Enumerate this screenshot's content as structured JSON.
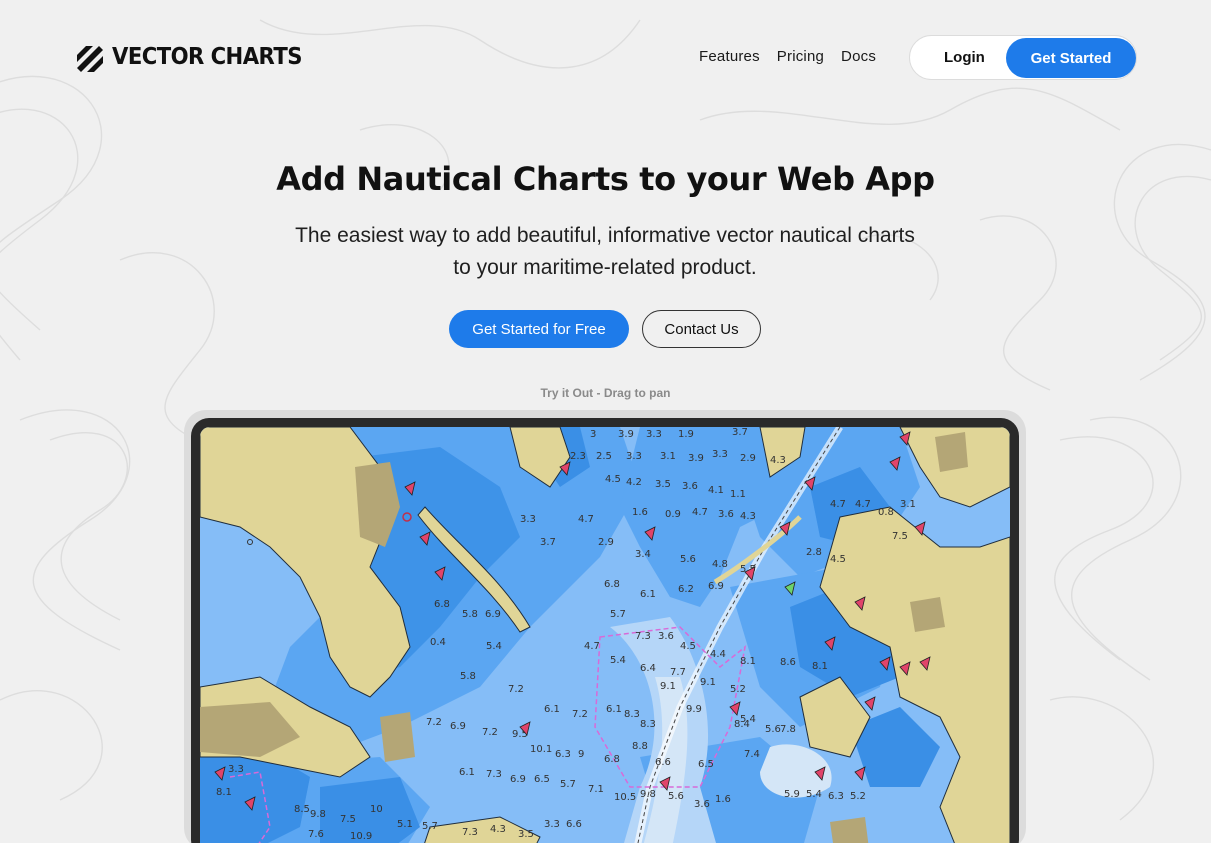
{
  "brand": {
    "name": "VECTOR CHARTS",
    "logo_icon": "diagonal-stripes-logo"
  },
  "nav": {
    "items": [
      {
        "label": "Features"
      },
      {
        "label": "Pricing"
      },
      {
        "label": "Docs"
      }
    ],
    "login_label": "Login",
    "get_started_label": "Get Started"
  },
  "hero": {
    "title": "Add Nautical Charts to your Web App",
    "subtitle_line1": "The easiest way to add beautiful, informative vector nautical charts",
    "subtitle_line2": "to your maritime-related product.",
    "primary_cta": "Get Started for Free",
    "secondary_cta": "Contact Us"
  },
  "demo": {
    "hint": "Try it Out - Drag to pan",
    "depth_soundings": [
      "3",
      "3.9",
      "3.3",
      "1.9",
      "3.7",
      "2.3",
      "2.5",
      "3.3",
      "3.1",
      "3.9",
      "3.3",
      "2.9",
      "4.3",
      "4.5",
      "4.2",
      "3.5",
      "3.6",
      "4.1",
      "1.1",
      "1.6",
      "0.9",
      "4.7",
      "3.6",
      "4.3",
      "3.3",
      "4.7",
      "3.7",
      "2.9",
      "3.4",
      "5.6",
      "4.8",
      "5.5",
      "4.7",
      "4.7",
      "0.8",
      "3.1",
      "7.5",
      "2.8",
      "4.5",
      "6.8",
      "6.1",
      "6.2",
      "6.9",
      "6.8",
      "5.8",
      "6.9",
      "5.7",
      "7.3",
      "3.6",
      "4.5",
      "4.4",
      "0.4",
      "5.4",
      "4.7",
      "5.4",
      "6.4",
      "7.7",
      "9.1",
      "9.1",
      "8.1",
      "8.6",
      "8.1",
      "5.2",
      "5.4",
      "5.8",
      "7.2",
      "6.1",
      "7.2",
      "6.1",
      "8.3",
      "8.3",
      "9.9",
      "8.4",
      "5.6",
      "7.8",
      "7.2",
      "6.9",
      "7.2",
      "9.5",
      "10.1",
      "6.3",
      "9",
      "6.8",
      "8.8",
      "6.6",
      "6.5",
      "7.4",
      "6.1",
      "7.3",
      "6.9",
      "6.5",
      "5.7",
      "7.1",
      "10.5",
      "9.8",
      "5.6",
      "3.6",
      "1.6",
      "5.9",
      "5.4",
      "6.3",
      "5.2",
      "3.3",
      "8.1",
      "8.5",
      "7.5",
      "10.9",
      "7.6",
      "9.8",
      "10",
      "5.1",
      "5.7",
      "7.3",
      "4.3",
      "3.5",
      "3.3",
      "6.6"
    ],
    "colors": {
      "land": "#e0d597",
      "land_dark": "#b4a676",
      "shallow_water": "#3a8fe6",
      "mid_water": "#5ba6f2",
      "deep_water": "#85bdf7",
      "deepest_water": "#b5d6f8",
      "channel": "#d4e6f7",
      "coastline": "#1f2d3d",
      "restricted_area": "#d86ad8",
      "hazard_marker": "#e0446a"
    }
  }
}
